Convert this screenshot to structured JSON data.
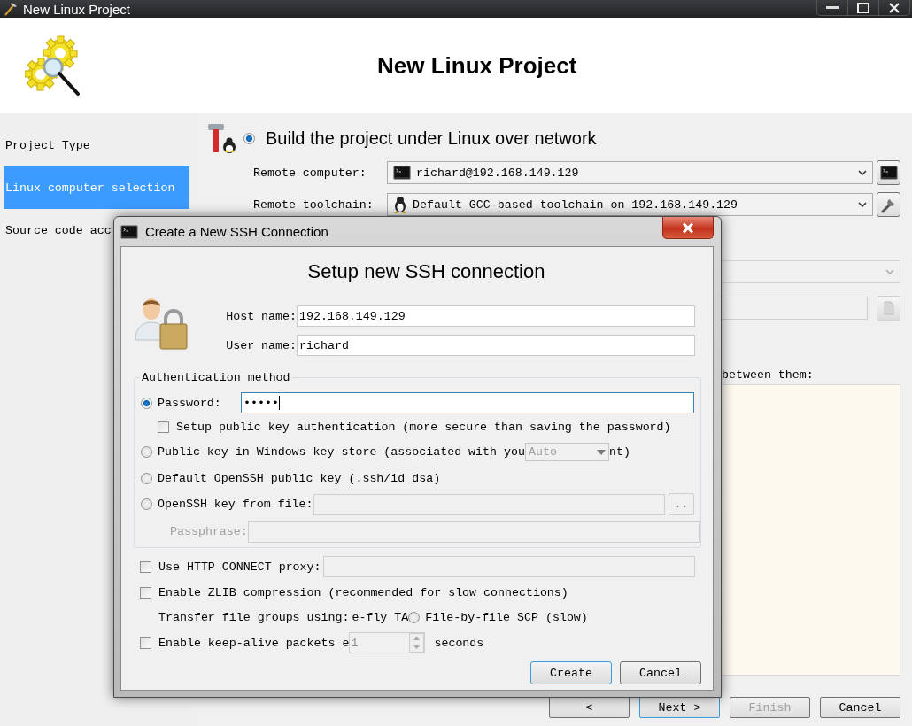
{
  "window": {
    "title": "New Linux Project"
  },
  "header": {
    "title": "New Linux Project"
  },
  "steps": [
    {
      "label": "Project Type",
      "selected": false
    },
    {
      "label": "Linux computer selection",
      "selected": true
    },
    {
      "label": "Source code acc",
      "selected": false
    }
  ],
  "build_option": {
    "label": "Build the project under Linux over network",
    "selected": true
  },
  "remote_fields": [
    {
      "label": "Remote computer:",
      "value": "richard@192.168.149.129",
      "kind": "computer"
    },
    {
      "label": "Remote toolchain:",
      "value": "Default GCC-based toolchain on 192.168.149.129",
      "kind": "toolchain"
    }
  ],
  "other_computer": {
    "disabled": true,
    "list_label": "between them:"
  },
  "wizard_buttons": [
    {
      "label": "<",
      "disabled": false,
      "default": false
    },
    {
      "label": "Next >",
      "disabled": false,
      "default": true
    },
    {
      "label": "Finish",
      "disabled": true,
      "default": false
    },
    {
      "label": "Cancel",
      "disabled": false,
      "default": false
    }
  ],
  "dialog": {
    "title": "Create a New SSH Connection",
    "heading": "Setup new SSH connection",
    "fields": [
      {
        "label": "Host name:",
        "value": "192.168.149.129"
      },
      {
        "label": "User name:",
        "value": "richard"
      }
    ],
    "auth": {
      "title": "Authentication method",
      "password": {
        "label": "Password:",
        "selected": true,
        "value": "•••••"
      },
      "setup_key": {
        "label": "Setup public key authentication (more secure than saving the password)",
        "checked": false
      },
      "windows_store": {
        "label": "Public key in Windows key store (associated with you",
        "selected": false,
        "store": "Auto",
        "tail": "nt)"
      },
      "default_key": {
        "label": "Default OpenSSH public key (.ssh/id_dsa)",
        "selected": false
      },
      "key_file": {
        "label": "OpenSSH key from file:",
        "selected": false,
        "browse": ".."
      },
      "passphrase": {
        "label": "Passphrase:",
        "disabled": true
      }
    },
    "proxy": {
      "label": "Use HTTP CONNECT proxy:",
      "checked": false
    },
    "zlib": {
      "label": "Enable ZLIB compression (recommended for slow connections)",
      "checked": false
    },
    "transfer": {
      "label": "Transfer file groups using:",
      "option_1": "e-fly TA",
      "option_2": {
        "label": "File-by-file SCP (slow)",
        "selected": false
      }
    },
    "keepalive": {
      "label": "Enable keep-alive packets e",
      "checked": false,
      "value": "1",
      "unit": "seconds"
    },
    "buttons": [
      {
        "label": "Create",
        "default": true
      },
      {
        "label": "Cancel",
        "default": false
      }
    ]
  }
}
